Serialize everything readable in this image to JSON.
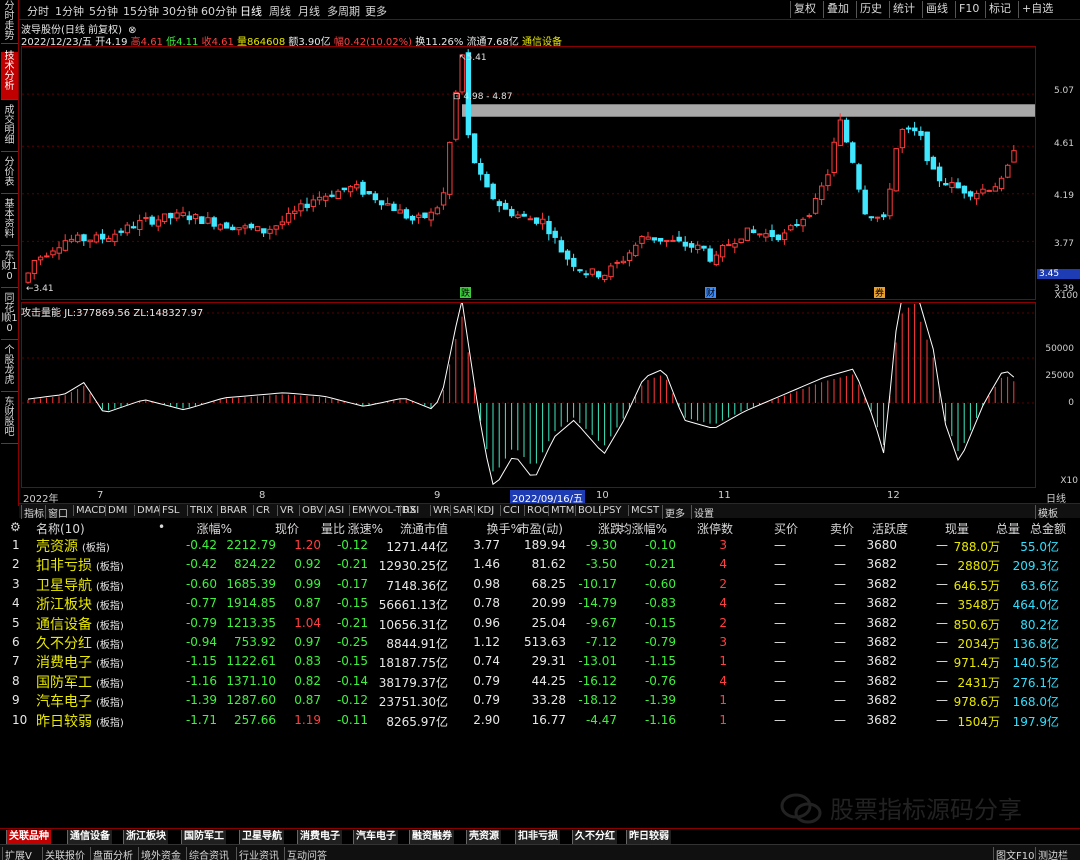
{
  "sidebar": [
    "分时走势",
    "技术分析",
    "成交明细",
    "分价表",
    "基本资料",
    "东财10",
    "同花顺10",
    "个股龙虎",
    "东财股吧"
  ],
  "periods": [
    "分时",
    "1分钟",
    "5分钟",
    "15分钟",
    "30分钟",
    "60分钟",
    "日线",
    "周线",
    "月线",
    "多周期",
    "更多"
  ],
  "tools": [
    "复权",
    "叠加",
    "历史",
    "统计",
    "画线",
    "F10",
    "标记",
    "+自选"
  ],
  "stock": {
    "name": "波导股份(日线 前复权)",
    "date": "2022/12/23/五",
    "open_l": "开",
    "open": "4.19",
    "high_l": "高",
    "high": "4.61",
    "low_l": "低",
    "low": "4.11",
    "close_l": "收",
    "close": "4.61",
    "vol_l": "量",
    "vol": "864608",
    "amt_l": "额",
    "amt": "3.90亿",
    "chg_l": "幅",
    "chg": "0.42(10.02%)",
    "turn_l": "换",
    "turn": "11.26%",
    "float_l": "流通",
    "float": "7.68亿",
    "sector": "通信设备"
  },
  "price_axis": [
    "5.07",
    "4.61",
    "4.19",
    "3.77"
  ],
  "price_cur": "3.45",
  "price_low": "3.39",
  "price_x": "X100",
  "annot": {
    "max": "5.41",
    "min": "3.41",
    "band": "4.98 - 4.87",
    "m1": "跌",
    "m2": "财",
    "m3": "券"
  },
  "ind": {
    "title": "攻击量能",
    "jl_l": "JL:",
    "jl": "377869.56",
    "zl_l": "ZL:",
    "zl": "148327.97",
    "axis": [
      "50000",
      "25000",
      "0"
    ],
    "x": "X10"
  },
  "dates": {
    "y": "2022年",
    "m7": "7",
    "m8": "8",
    "m9": "9",
    "sel": "2022/09/16/五",
    "m10": "10",
    "m11": "11",
    "m12": "12",
    "right": "日线"
  },
  "itabs": [
    "指标",
    "窗口",
    "MACD",
    "DMI",
    "DMA",
    "FSL",
    "TRIX",
    "BRAR",
    "CR",
    "VR",
    "OBV",
    "ASI",
    "EMV",
    "VOL-TDX",
    "RSI",
    "WR",
    "SAR",
    "KDJ",
    "CCI",
    "ROC",
    "MTM",
    "BOLL",
    "PSY",
    "MCST",
    "更多",
    "设置"
  ],
  "itab_right": "模板",
  "table": {
    "headers": [
      "名称(10)",
      "•",
      "涨幅%",
      "现价",
      "量比",
      "涨速%",
      "流通市值",
      "换手%",
      "市盈(动)",
      "涨跌",
      "均涨幅%",
      "涨停数",
      "买价",
      "卖价",
      "活跃度",
      "现量",
      "总量",
      "总金额"
    ],
    "rows": [
      {
        "i": "1",
        "n": "壳资源",
        "t": "(板指)",
        "chg": "-0.42",
        "px": "2212.79",
        "lb": "1.20",
        "sp": "-0.12",
        "mv": "1271.44亿",
        "hs": "3.77",
        "pe": "189.94",
        "zd": "-9.30",
        "avg": "-0.10",
        "zt": "3",
        "buy": "—",
        "sell": "—",
        "hy": "3680",
        "xl": "—",
        "zl": "788.0万",
        "je": "55.0亿"
      },
      {
        "i": "2",
        "n": "扣非亏损",
        "t": "(板指)",
        "chg": "-0.42",
        "px": "824.22",
        "lb": "0.92",
        "sp": "-0.21",
        "mv": "12930.25亿",
        "hs": "1.46",
        "pe": "81.62",
        "zd": "-3.50",
        "avg": "-0.21",
        "zt": "4",
        "buy": "—",
        "sell": "—",
        "hy": "3682",
        "xl": "—",
        "zl": "2880万",
        "je": "209.3亿"
      },
      {
        "i": "3",
        "n": "卫星导航",
        "t": "(板指)",
        "chg": "-0.60",
        "px": "1685.39",
        "lb": "0.99",
        "sp": "-0.17",
        "mv": "7148.36亿",
        "hs": "0.98",
        "pe": "68.25",
        "zd": "-10.17",
        "avg": "-0.60",
        "zt": "2",
        "buy": "—",
        "sell": "—",
        "hy": "3682",
        "xl": "—",
        "zl": "646.5万",
        "je": "63.6亿"
      },
      {
        "i": "4",
        "n": "浙江板块",
        "t": "(板指)",
        "chg": "-0.77",
        "px": "1914.85",
        "lb": "0.87",
        "sp": "-0.15",
        "mv": "56661.13亿",
        "hs": "0.78",
        "pe": "20.99",
        "zd": "-14.79",
        "avg": "-0.83",
        "zt": "4",
        "buy": "—",
        "sell": "—",
        "hy": "3682",
        "xl": "—",
        "zl": "3548万",
        "je": "464.0亿"
      },
      {
        "i": "5",
        "n": "通信设备",
        "t": "(板指)",
        "chg": "-0.79",
        "px": "1213.35",
        "lb": "1.04",
        "sp": "-0.21",
        "mv": "10656.31亿",
        "hs": "0.96",
        "pe": "25.04",
        "zd": "-9.67",
        "avg": "-0.15",
        "zt": "2",
        "buy": "—",
        "sell": "—",
        "hy": "3682",
        "xl": "—",
        "zl": "850.6万",
        "je": "80.2亿"
      },
      {
        "i": "6",
        "n": "久不分红",
        "t": "(板指)",
        "chg": "-0.94",
        "px": "753.92",
        "lb": "0.97",
        "sp": "-0.25",
        "mv": "8844.91亿",
        "hs": "1.12",
        "pe": "513.63",
        "zd": "-7.12",
        "avg": "-0.79",
        "zt": "3",
        "buy": "—",
        "sell": "—",
        "hy": "3682",
        "xl": "—",
        "zl": "2034万",
        "je": "136.8亿"
      },
      {
        "i": "7",
        "n": "消费电子",
        "t": "(板指)",
        "chg": "-1.15",
        "px": "1122.61",
        "lb": "0.83",
        "sp": "-0.15",
        "mv": "18187.75亿",
        "hs": "0.74",
        "pe": "29.31",
        "zd": "-13.01",
        "avg": "-1.15",
        "zt": "1",
        "buy": "—",
        "sell": "—",
        "hy": "3682",
        "xl": "—",
        "zl": "971.4万",
        "je": "140.5亿"
      },
      {
        "i": "8",
        "n": "国防军工",
        "t": "(板指)",
        "chg": "-1.16",
        "px": "1371.10",
        "lb": "0.82",
        "sp": "-0.14",
        "mv": "38179.37亿",
        "hs": "0.79",
        "pe": "44.25",
        "zd": "-16.12",
        "avg": "-0.76",
        "zt": "4",
        "buy": "—",
        "sell": "—",
        "hy": "3682",
        "xl": "—",
        "zl": "2431万",
        "je": "276.1亿"
      },
      {
        "i": "9",
        "n": "汽车电子",
        "t": "(板指)",
        "chg": "-1.39",
        "px": "1287.60",
        "lb": "0.87",
        "sp": "-0.12",
        "mv": "23751.30亿",
        "hs": "0.79",
        "pe": "33.28",
        "zd": "-18.12",
        "avg": "-1.39",
        "zt": "1",
        "buy": "—",
        "sell": "—",
        "hy": "3682",
        "xl": "—",
        "zl": "978.6万",
        "je": "168.0亿"
      },
      {
        "i": "10",
        "n": "昨日较弱",
        "t": "(板指)",
        "chg": "-1.71",
        "px": "257.66",
        "lb": "1.19",
        "sp": "-0.11",
        "mv": "8265.97亿",
        "hs": "2.90",
        "pe": "16.77",
        "zd": "-4.47",
        "avg": "-1.16",
        "zt": "1",
        "buy": "—",
        "sell": "—",
        "hy": "3682",
        "xl": "—",
        "zl": "1504万",
        "je": "197.9亿"
      }
    ]
  },
  "bottom_tabs": [
    "关联品种",
    "通信设备",
    "浙江板块",
    "国防军工",
    "卫星导航",
    "消费电子",
    "汽车电子",
    "融资融券",
    "壳资源",
    "扣非亏损",
    "久不分红",
    "昨日较弱"
  ],
  "status": [
    "扩展V",
    "关联报价",
    "盘面分析",
    "境外资金",
    "综合资讯",
    "行业资讯",
    "互动问答"
  ],
  "status_right": [
    "图文F10",
    "测边栏"
  ],
  "watermark": "股票指标源码分享",
  "colors": {
    "up": "#ff4040",
    "down": "#30e0ff",
    "bg": "#000000",
    "frame": "#8a0000"
  }
}
